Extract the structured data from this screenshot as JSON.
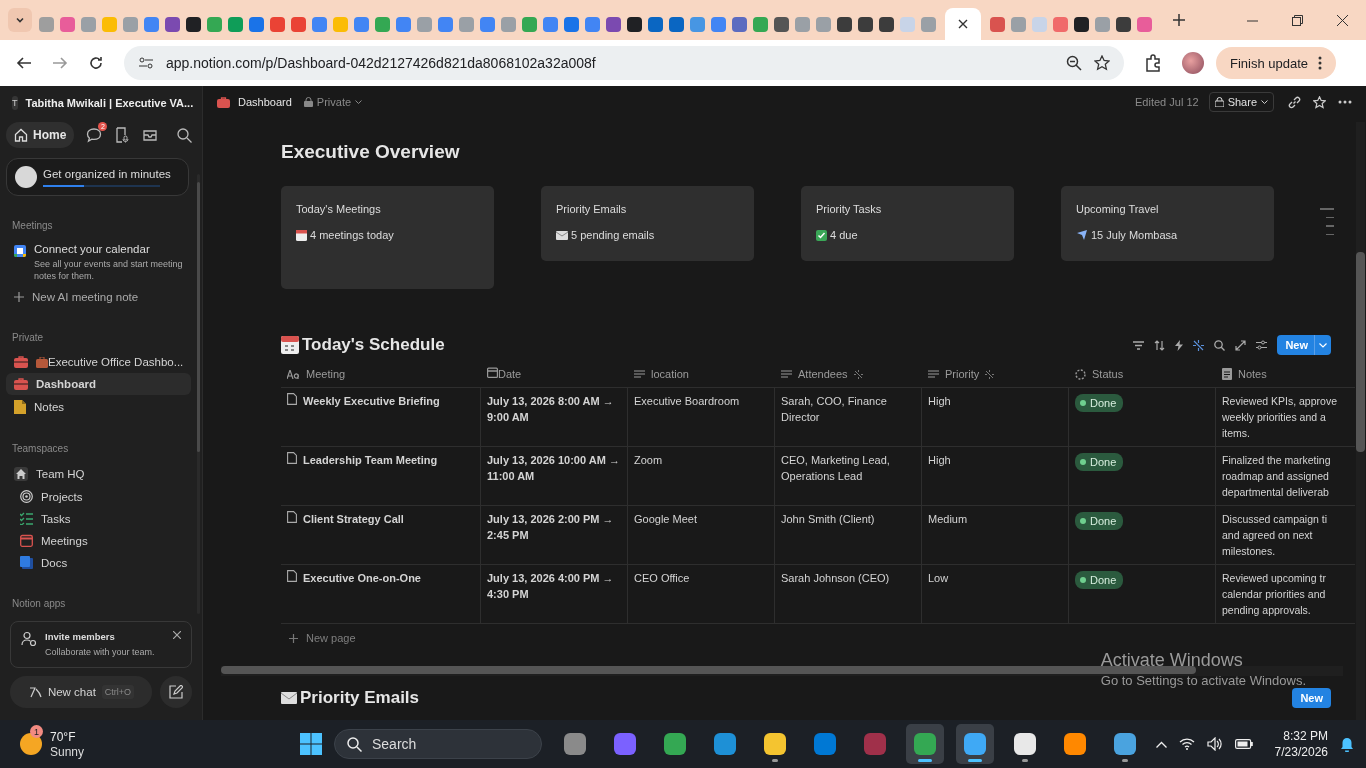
{
  "browser": {
    "tabs": [
      {
        "color": "#9e9e9e",
        "selected": false
      },
      {
        "color": "#e85d9a",
        "selected": false
      },
      {
        "color": "#9aa0a6",
        "selected": false
      },
      {
        "color": "#fbbc04",
        "selected": false
      },
      {
        "color": "#9aa0a6",
        "selected": false
      },
      {
        "color": "#4285f4",
        "selected": false
      },
      {
        "color": "#7b4ab0",
        "selected": false
      },
      {
        "color": "#202124",
        "selected": false
      },
      {
        "color": "#34a853",
        "selected": false
      },
      {
        "color": "#0f9d58",
        "selected": false
      },
      {
        "color": "#1a73e8",
        "selected": false
      },
      {
        "color": "#ea4335",
        "selected": false
      },
      {
        "color": "#ea4335",
        "selected": false
      },
      {
        "color": "#4285f4",
        "selected": false
      },
      {
        "color": "#fbbc04",
        "selected": false
      },
      {
        "color": "#4285f4",
        "selected": false
      },
      {
        "color": "#34a853",
        "selected": false
      },
      {
        "color": "#4285f4",
        "selected": false
      },
      {
        "color": "#9aa0a6",
        "selected": false
      },
      {
        "color": "#4285f4",
        "selected": false
      },
      {
        "color": "#9aa0a6",
        "selected": false
      },
      {
        "color": "#4285f4",
        "selected": false
      },
      {
        "color": "#9aa0a6",
        "selected": false
      },
      {
        "color": "#34a853",
        "selected": false
      },
      {
        "color": "#4285f4",
        "selected": false
      },
      {
        "color": "#1a73e8",
        "selected": false
      },
      {
        "color": "#4285f4",
        "selected": false
      },
      {
        "color": "#7b4ab0",
        "selected": false
      },
      {
        "color": "#202124",
        "selected": false
      },
      {
        "color": "#0a66c2",
        "selected": false
      },
      {
        "color": "#0a66c2",
        "selected": false
      },
      {
        "color": "#4796e3",
        "selected": false
      },
      {
        "color": "#4285f4",
        "selected": false
      },
      {
        "color": "#5c6bc0",
        "selected": false
      },
      {
        "color": "#34a853",
        "selected": false
      },
      {
        "color": "#555555",
        "selected": false
      },
      {
        "color": "#9aa0a6",
        "selected": false
      },
      {
        "color": "#9aa0a6",
        "selected": false
      },
      {
        "color": "#3c3c3c",
        "selected": false
      },
      {
        "color": "#3c3c3c",
        "selected": false
      },
      {
        "color": "#3c3c3c",
        "selected": false
      },
      {
        "color": "#c8d4e8",
        "selected": false
      },
      {
        "color": "#9aa0a6",
        "selected": false
      },
      {
        "selected": true
      },
      {
        "color": "#d9534f",
        "selected": false
      },
      {
        "color": "#9aa0a6",
        "selected": false
      },
      {
        "color": "#c8d4e8",
        "selected": false
      },
      {
        "color": "#f06a6a",
        "selected": false
      },
      {
        "color": "#202124",
        "selected": false
      },
      {
        "color": "#9aa0a6",
        "selected": false
      },
      {
        "color": "#3c3c3c",
        "selected": false
      },
      {
        "color": "#e85d9a",
        "selected": false
      }
    ],
    "url": "app.notion.com/p/Dashboard-042d2127426d821da8068102a32a008f",
    "update_button": "Finish update"
  },
  "sidebar": {
    "workspace_initial": "T",
    "workspace": "Tabitha Mwikali | Executive VA...",
    "home": "Home",
    "inbox_badge": "2",
    "onboarding": {
      "label": "Get organized in minutes",
      "level": 0.35
    },
    "meetings": {
      "title": "Meetings",
      "connect": "Connect your calendar",
      "connect_hint": "See all your events and start meeting notes for them.",
      "new_note": "New AI meeting note"
    },
    "private": {
      "title": "Private",
      "items": [
        {
          "label": "Executive Office Dashbo...",
          "kind": "briefcase",
          "selected": false
        },
        {
          "label": "Dashboard",
          "kind": "briefcase",
          "selected": true
        },
        {
          "label": "Notes",
          "kind": "note",
          "selected": false
        }
      ]
    },
    "teamspaces": {
      "title": "Teamspaces",
      "team": "Team HQ",
      "items": [
        {
          "label": "Projects",
          "kind": "target"
        },
        {
          "label": "Tasks",
          "kind": "checklist"
        },
        {
          "label": "Meetings",
          "kind": "calendar"
        },
        {
          "label": "Docs",
          "kind": "docs"
        }
      ]
    },
    "apps_title": "Notion apps",
    "invite": {
      "title": "Invite members",
      "text": "Collaborate with your team."
    },
    "new_chat": "New chat",
    "new_chat_shortcut": "Ctrl+O"
  },
  "topbar": {
    "page": "Dashboard",
    "visibility": "Private",
    "edited": "Edited Jul 12",
    "share": "Share"
  },
  "page": {
    "title": "Executive Overview",
    "cards": [
      {
        "title": "Today's Meetings",
        "kind": "calendar",
        "text": "4 meetings today"
      },
      {
        "title": "Priority Emails",
        "kind": "mail",
        "text": "5 pending emails"
      },
      {
        "title": "Priority Tasks",
        "kind": "check",
        "text": "4 due"
      },
      {
        "title": "Upcoming Travel",
        "kind": "plane",
        "text": "15 July Mombasa"
      }
    ],
    "schedule": {
      "title": "Today's Schedule",
      "new_button": "New",
      "columns": [
        {
          "label": "Meeting",
          "kind": "title"
        },
        {
          "label": "Date",
          "kind": "date"
        },
        {
          "label": "location",
          "kind": "text"
        },
        {
          "label": "Attendees",
          "kind": "text_ai"
        },
        {
          "label": "Priority",
          "kind": "text_ai"
        },
        {
          "label": "Status",
          "kind": "status"
        },
        {
          "label": "Notes",
          "kind": "notes"
        }
      ],
      "rows": [
        {
          "meeting": "Weekly Executive Briefing",
          "date": "July 13, 2026 8:00 AM → 9:00 AM",
          "location": "Executive Boardroom",
          "attendees": "Sarah, COO, Finance Director",
          "priority": "High",
          "status": "Done",
          "notes": [
            "Reviewed KPIs, approve",
            "weekly priorities and a",
            "items."
          ]
        },
        {
          "meeting": "Leadership Team Meeting",
          "date": "July 13, 2026 10:00 AM → 11:00 AM",
          "location": "Zoom",
          "attendees": "CEO, Marketing Lead, Operations Lead",
          "priority": "High",
          "status": "Done",
          "notes": [
            "Finalized the marketing",
            "roadmap and assigned",
            "departmental deliverab"
          ]
        },
        {
          "meeting": "Client Strategy Call",
          "date": "July 13, 2026 2:00 PM → 2:45 PM",
          "location": "Google Meet",
          "attendees": "John Smith (Client)",
          "priority": "Medium",
          "status": "Done",
          "notes": [
            "Discussed campaign ti",
            "and agreed on next",
            "milestones."
          ]
        },
        {
          "meeting": "Executive One-on-One",
          "date": "July 13, 2026 4:00 PM → 4:30 PM",
          "location": "CEO Office",
          "attendees": "Sarah Johnson (CEO)",
          "priority": "Low",
          "status": "Done",
          "notes": [
            "Reviewed upcoming tr",
            "calendar priorities and",
            "pending approvals."
          ]
        }
      ],
      "new_page": "New page"
    },
    "emails": {
      "title": "Priority Emails",
      "new_button": "New"
    }
  },
  "activation": {
    "title": "Activate Windows",
    "text": "Go to Settings to activate Windows."
  },
  "taskbar": {
    "temperature": "70°F",
    "weather": "Sunny",
    "weather_badge": "1",
    "search": "Search",
    "apps": [
      {
        "color": "#8a8a8a",
        "running": false,
        "selected": false
      },
      {
        "color": "#7b61ff",
        "running": false,
        "selected": false
      },
      {
        "color": "#34a853",
        "running": false,
        "selected": false
      },
      {
        "color": "#1e90d6",
        "running": false,
        "selected": false
      },
      {
        "color": "#f4c430",
        "running": true,
        "selected": false
      },
      {
        "color": "#0078d4",
        "running": false,
        "selected": false
      },
      {
        "color": "#a0304a",
        "running": false,
        "selected": false
      },
      {
        "color": "#34a853",
        "running": true,
        "selected": true
      },
      {
        "color": "#3fa9f5",
        "running": true,
        "selected": true
      },
      {
        "color": "#e8e8e8",
        "running": true,
        "selected": false
      },
      {
        "color": "#ff8800",
        "running": false,
        "selected": false
      },
      {
        "color": "#4aa3df",
        "running": true,
        "selected": false
      }
    ],
    "time": "8:32 PM",
    "date": "7/23/2026"
  }
}
